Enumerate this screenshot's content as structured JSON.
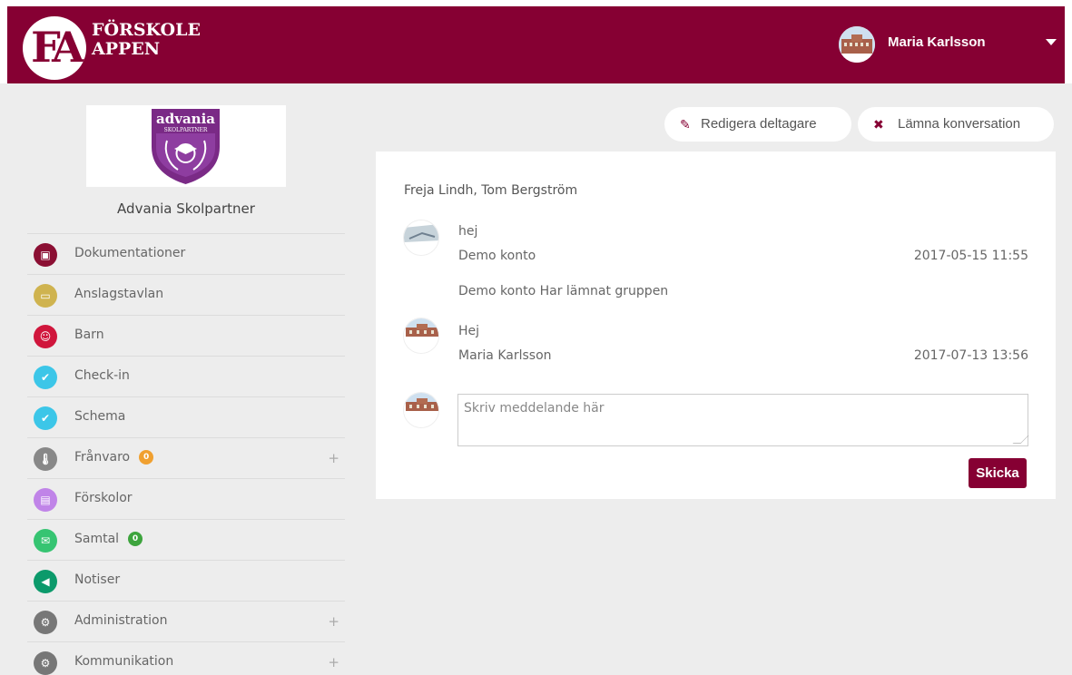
{
  "app": {
    "logo_mark": "FA",
    "logo_line1": "FÖRSKOLE",
    "logo_line2": "APPEN",
    "brand_color": "#860033"
  },
  "user": {
    "name": "Maria Karlsson"
  },
  "school": {
    "logo_top": "advania",
    "logo_sub": "SKOLPARTNER",
    "name": "Advania Skolpartner"
  },
  "sidebar": {
    "items": [
      {
        "label": "Dokumentationer",
        "icon": "image-icon",
        "color": "#8b0f33"
      },
      {
        "label": "Anslagstavlan",
        "icon": "monitor-icon",
        "color": "#cfb34f"
      },
      {
        "label": "Barn",
        "icon": "smiley-icon",
        "color": "#d0163c"
      },
      {
        "label": "Check-in",
        "icon": "check-icon",
        "color": "#3cc6e8"
      },
      {
        "label": "Schema",
        "icon": "check-icon",
        "color": "#3cc6e8"
      },
      {
        "label": "Frånvaro",
        "icon": "thermometer-icon",
        "color": "#888888",
        "badge": "0",
        "badge_color": "#f0a030"
      },
      {
        "label": "Förskolor",
        "icon": "book-icon",
        "color": "#c084e8"
      },
      {
        "label": "Samtal",
        "icon": "envelope-icon",
        "color": "#36c472",
        "badge": "0",
        "badge_color": "#3da43d"
      },
      {
        "label": "Notiser",
        "icon": "megaphone-icon",
        "color": "#0c9a6b"
      },
      {
        "label": "Administration",
        "icon": "gear-icon",
        "color": "#777777"
      },
      {
        "label": "Kommunikation",
        "icon": "gear-icon",
        "color": "#777777"
      }
    ]
  },
  "actions": {
    "edit_label": "Redigera deltagare",
    "leave_label": "Lämna konversation"
  },
  "conversation": {
    "participants": "Freja Lindh, Tom Bergström",
    "messages": [
      {
        "text": "hej",
        "author": "Demo konto",
        "time": "2017-05-15 11:55"
      },
      {
        "text": "Hej",
        "author": "Maria Karlsson",
        "time": "2017-07-13 13:56"
      }
    ],
    "system_note": "Demo konto Har lämnat gruppen",
    "input_placeholder": "Skriv meddelande här",
    "send_label": "Skicka"
  }
}
